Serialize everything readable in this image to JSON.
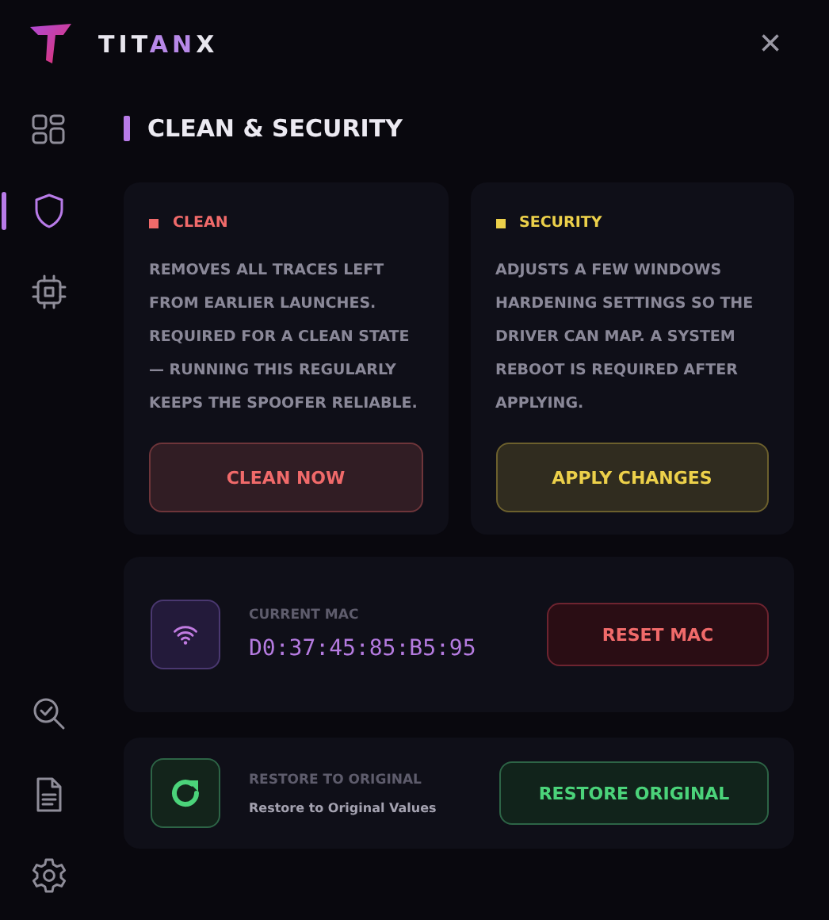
{
  "brand": {
    "parts": [
      {
        "text": "TIT",
        "accent": false
      },
      {
        "text": "AN",
        "accent": true
      },
      {
        "text": "X",
        "accent": false
      }
    ]
  },
  "window": {
    "close": "×"
  },
  "sidebar": {
    "items": [
      {
        "kind": "dashboard",
        "selected": false
      },
      {
        "kind": "shield",
        "selected": true
      },
      {
        "kind": "chip",
        "selected": false
      }
    ],
    "bottom_items": [
      {
        "kind": "scan",
        "selected": false
      },
      {
        "kind": "document",
        "selected": false
      },
      {
        "kind": "settings",
        "selected": false
      }
    ]
  },
  "page": {
    "title": "CLEAN & SECURITY"
  },
  "cards": [
    {
      "tag": "CLEAN",
      "color": "#f06a6a",
      "text": "REMOVES ALL TRACES LEFT FROM EARLIER LAUNCHES. REQUIRED FOR A CLEAN STATE — RUNNING THIS REGULARLY KEEPS THE SPOOFER RELIABLE.",
      "button": "CLEAN NOW"
    },
    {
      "tag": "SECURITY",
      "color": "#ecd04a",
      "text": "ADJUSTS A FEW WINDOWS HARDENING SETTINGS SO THE DRIVER CAN MAP. A SYSTEM REBOOT IS REQUIRED AFTER APPLYING.",
      "button": "APPLY CHANGES"
    }
  ],
  "mac": {
    "label": "CURRENT MAC",
    "value": "D0:37:45:85:B5:95",
    "button": "RESET MAC"
  },
  "restore": {
    "label": "RESTORE TO ORIGINAL",
    "sub": "Restore to Original Values",
    "button": "RESTORE ORIGINAL"
  }
}
